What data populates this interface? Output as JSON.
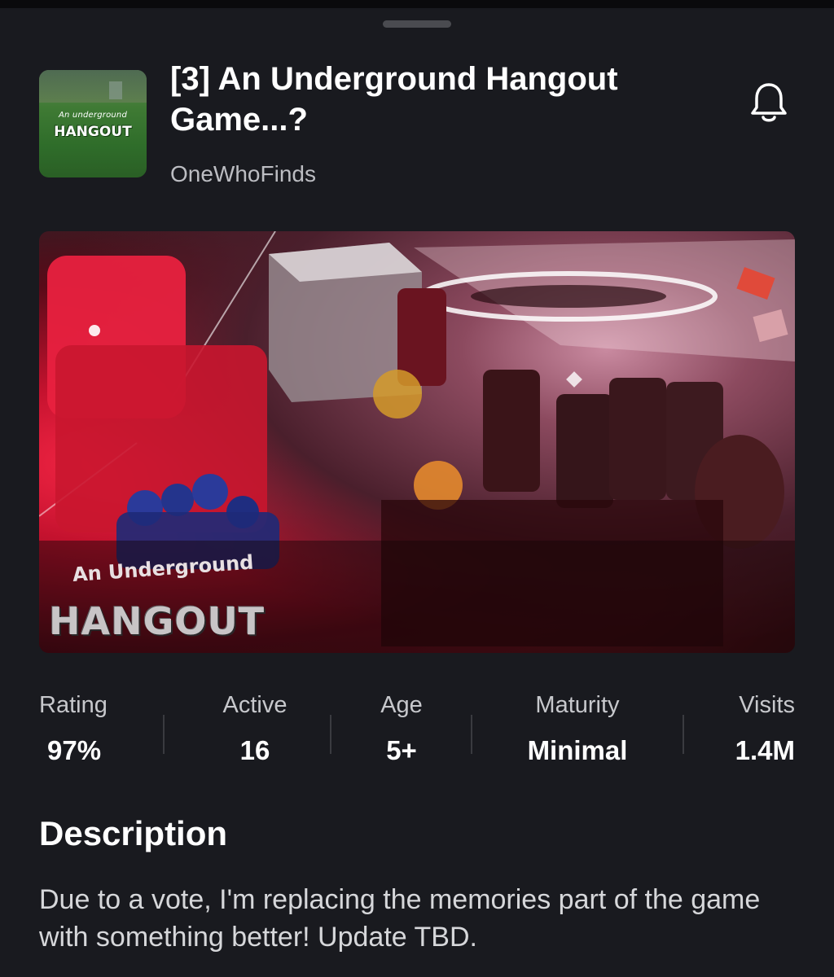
{
  "game": {
    "title": "[3] An Underground Hangout Game...?",
    "creator": "OneWhoFinds",
    "icon_text_small": "An underground",
    "icon_text_big": "HANGOUT"
  },
  "thumbnail": {
    "text_small": "An Underground",
    "text_big": "HANGOUT"
  },
  "stats": [
    {
      "label": "Rating",
      "value": "97%"
    },
    {
      "label": "Active",
      "value": "16"
    },
    {
      "label": "Age",
      "value": "5+"
    },
    {
      "label": "Maturity",
      "value": "Minimal"
    },
    {
      "label": "Visits",
      "value": "1.4M"
    }
  ],
  "description": {
    "heading": "Description",
    "text": "Due to a vote, I'm replacing the memories part of the game with something better! Update TBD."
  },
  "icons": {
    "notify": "bell-icon"
  },
  "colors": {
    "background": "#191a1f",
    "text_primary": "#ffffff",
    "text_secondary": "#bcbdc2",
    "icon_green": "#2f6d2a",
    "thumbnail_red": "#c4122e"
  }
}
